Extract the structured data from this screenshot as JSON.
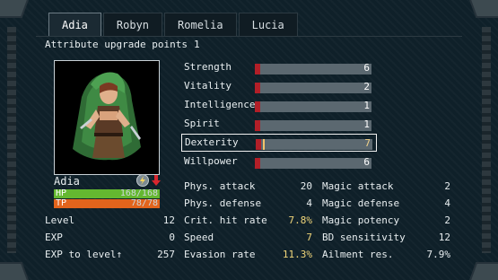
{
  "tabs": [
    {
      "label": "Adia",
      "active": true
    },
    {
      "label": "Robyn",
      "active": false
    },
    {
      "label": "Romelia",
      "active": false
    },
    {
      "label": "Lucia",
      "active": false
    }
  ],
  "upgrade": {
    "label": "Attribute upgrade points",
    "value": "1"
  },
  "character": {
    "name": "Adia",
    "hp_label": "HP",
    "hp_value": "168/168",
    "hp_fraction": 1.0,
    "tp_label": "TP",
    "tp_value": "78/78",
    "tp_fraction": 1.0,
    "status_icons": [
      "lightning-icon",
      "arrow-down-icon"
    ]
  },
  "level_stats": [
    {
      "label": "Level",
      "value": "12"
    },
    {
      "label": "EXP",
      "value": "0"
    },
    {
      "label": "EXP to level↑",
      "value": "257"
    }
  ],
  "attributes": [
    {
      "name": "Strength",
      "value": "6",
      "level": 6
    },
    {
      "name": "Vitality",
      "value": "2",
      "level": 2
    },
    {
      "name": "Intelligence",
      "value": "1",
      "level": 1
    },
    {
      "name": "Spirit",
      "value": "1",
      "level": 1
    },
    {
      "name": "Dexterity",
      "value": "7",
      "level": 7,
      "selected": true
    },
    {
      "name": "Willpower",
      "value": "6",
      "level": 6
    }
  ],
  "combat_left": [
    {
      "label": "Phys. attack",
      "value": "20",
      "highlight": false
    },
    {
      "label": "Phys. defense",
      "value": "4",
      "highlight": false
    },
    {
      "label": "Crit. hit rate",
      "value": "7.8%",
      "highlight": true
    },
    {
      "label": "Speed",
      "value": "7",
      "highlight": true
    },
    {
      "label": "Evasion rate",
      "value": "11.3%",
      "highlight": true
    }
  ],
  "combat_right": [
    {
      "label": "Magic attack",
      "value": "2"
    },
    {
      "label": "Magic defense",
      "value": "4"
    },
    {
      "label": "Magic potency",
      "value": "2"
    },
    {
      "label": "BD sensitivity",
      "value": "12"
    },
    {
      "label": "Ailment res.",
      "value": "7.9%"
    }
  ],
  "colors": {
    "hp": "#64b830",
    "tp": "#e2641c",
    "attr_fill": "#b21f28",
    "highlight": "#f1d67a"
  }
}
